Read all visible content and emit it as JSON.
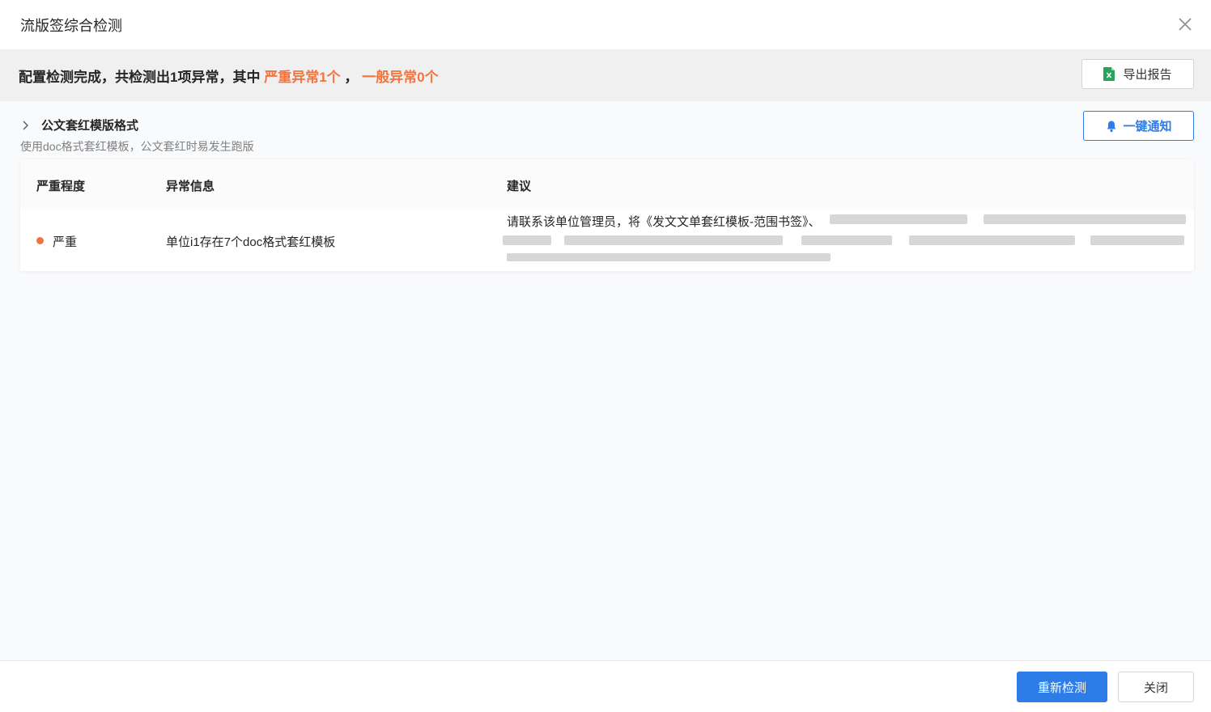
{
  "dialog": {
    "title": "流版签综合检测"
  },
  "summary": {
    "prefix": "配置检测完成，共检测出1项异常，其中",
    "severe": "严重异常1个",
    "separator": "，",
    "normal": "一般异常0个",
    "warn_color": "#f5733e",
    "export_label": "导出报告"
  },
  "group": {
    "title": "公文套红模版格式",
    "description": "使用doc格式套红模板，公文套红时易发生跑版",
    "notify_label": "一键通知",
    "accent_color": "#2e7ce8"
  },
  "table": {
    "headers": [
      "严重程度",
      "异常信息",
      "建议"
    ],
    "rows": [
      {
        "severity": "严重",
        "message": "单位i1存在7个doc格式套红模板",
        "advice": "请联系该单位管理员，将《发文文单套红模板-范围书签》、"
      }
    ]
  },
  "footer": {
    "recheck_label": "重新检测",
    "close_label": "关闭"
  }
}
